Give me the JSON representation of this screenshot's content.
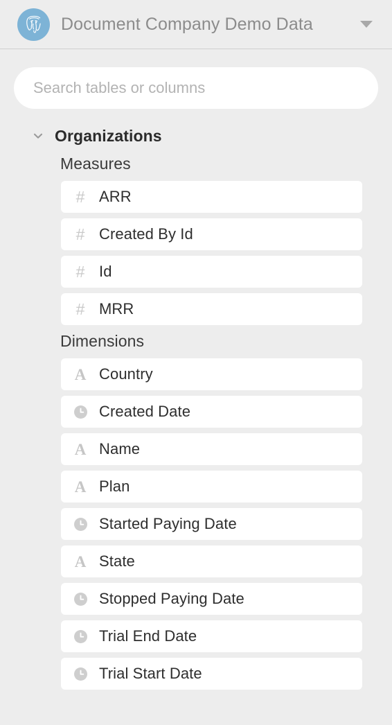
{
  "header": {
    "logo_icon": "postgres-elephant-icon",
    "logo_bg_color": "#7db3d6",
    "title": "Document Company Demo Data",
    "caret_icon": "triangle-down-icon"
  },
  "search": {
    "placeholder": "Search tables or columns",
    "value": ""
  },
  "group": {
    "name": "Organizations",
    "expanded": true,
    "chevron_icon": "chevron-down-icon",
    "sections": [
      {
        "title": "Measures",
        "fields": [
          {
            "label": "ARR",
            "type": "number",
            "icon": "hash-icon",
            "glyph": "#"
          },
          {
            "label": "Created By Id",
            "type": "number",
            "icon": "hash-icon",
            "glyph": "#"
          },
          {
            "label": "Id",
            "type": "number",
            "icon": "hash-icon",
            "glyph": "#"
          },
          {
            "label": "MRR",
            "type": "number",
            "icon": "hash-icon",
            "glyph": "#"
          }
        ]
      },
      {
        "title": "Dimensions",
        "fields": [
          {
            "label": "Country",
            "type": "text",
            "icon": "letter-a-icon",
            "glyph": "A"
          },
          {
            "label": "Created Date",
            "type": "datetime",
            "icon": "clock-icon",
            "glyph": ""
          },
          {
            "label": "Name",
            "type": "text",
            "icon": "letter-a-icon",
            "glyph": "A"
          },
          {
            "label": "Plan",
            "type": "text",
            "icon": "letter-a-icon",
            "glyph": "A"
          },
          {
            "label": "Started Paying Date",
            "type": "datetime",
            "icon": "clock-icon",
            "glyph": ""
          },
          {
            "label": "State",
            "type": "text",
            "icon": "letter-a-icon",
            "glyph": "A"
          },
          {
            "label": "Stopped Paying Date",
            "type": "datetime",
            "icon": "clock-icon",
            "glyph": ""
          },
          {
            "label": "Trial End Date",
            "type": "datetime",
            "icon": "clock-icon",
            "glyph": ""
          },
          {
            "label": "Trial Start Date",
            "type": "datetime",
            "icon": "clock-icon",
            "glyph": ""
          }
        ]
      }
    ]
  },
  "colors": {
    "page_bg": "#ededed",
    "row_bg": "#ffffff",
    "icon_gray": "#c6c6c6",
    "label_dark": "#2e2e2e",
    "title_gray": "#8c8c8c"
  }
}
